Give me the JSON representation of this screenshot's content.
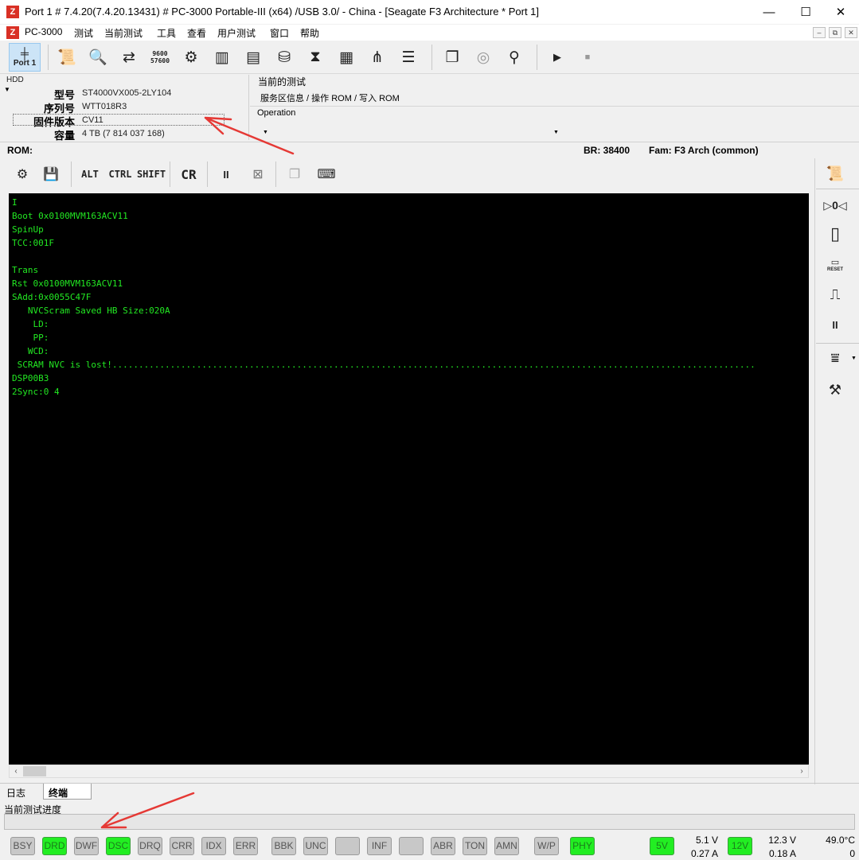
{
  "window": {
    "title": "Port 1 # 7.4.20(7.4.20.13431) # PC-3000 Portable-III (x64) /USB 3.0/ - China - [Seagate F3 Architecture * Port 1]",
    "min": "—",
    "max": "☐",
    "close": "✕",
    "icon_glyph": "Z"
  },
  "menu": {
    "items": [
      "PC-3000",
      "测试",
      "当前测试",
      "工具",
      "查看",
      "用户测试",
      "窗口",
      "帮助"
    ],
    "mdi": [
      "–",
      "⧉",
      "✕"
    ]
  },
  "toolbar": {
    "port_label": "Port 1",
    "baud_top": "9600",
    "baud_bottom": "57600",
    "play": "▶",
    "stop": "■"
  },
  "hdd": {
    "label": "HDD",
    "caret": "▼",
    "fields": [
      {
        "name": "型号",
        "value": "ST4000VX005-2LY104"
      },
      {
        "name": "序列号",
        "value": "WTT018R3"
      },
      {
        "name": "固件版本",
        "value": "CV11"
      },
      {
        "name": "容量",
        "value": "4 TB (7 814 037 168)"
      }
    ]
  },
  "current_test": {
    "title": "当前的测试",
    "value": "服务区信息 / 操作 ROM / 写入 ROM",
    "operation_label": "Operation",
    "caret": "▼"
  },
  "rom_bar": {
    "rom_label": "ROM:",
    "br": "BR: 38400",
    "fam": "Fam: F3 Arch (common)"
  },
  "term_toolbar": {
    "alt": "ALT",
    "ctrl": "CTRL",
    "shift": "SHIFT",
    "cr": "CR",
    "pause": "II"
  },
  "terminal": {
    "lines": [
      "I",
      "Boot 0x0100MVM163ACV11",
      "SpinUp",
      "TCC:001F",
      "",
      "Trans",
      "Rst 0x0100MVM163ACV11",
      "SAdd:0x0055C47F",
      "   NVCScram Saved HB Size:020A",
      "    LD:",
      "    PP:",
      "   WCD:",
      " SCRAM NVC is lost!..........................................................................................................................",
      "DSP00B3",
      "2Sync:0 4"
    ]
  },
  "right_panel": {
    "reset_label": "RESET",
    "pause": "II"
  },
  "tabs": [
    "日志",
    "终端"
  ],
  "progress": {
    "label": "当前测试进度",
    "fraction": 0
  },
  "leds": [
    {
      "label": "BSY",
      "on": false
    },
    {
      "label": "DRD",
      "on": true
    },
    {
      "label": "DWF",
      "on": false
    },
    {
      "label": "DSC",
      "on": true
    },
    {
      "label": "DRQ",
      "on": false
    },
    {
      "label": "CRR",
      "on": false
    },
    {
      "label": "IDX",
      "on": false
    },
    {
      "label": "ERR",
      "on": false
    },
    {
      "label": "BBK",
      "on": false
    },
    {
      "label": "UNC",
      "on": false
    },
    {
      "label": "",
      "on": false
    },
    {
      "label": "INF",
      "on": false
    },
    {
      "label": "",
      "on": false
    },
    {
      "label": "ABR",
      "on": false
    },
    {
      "label": "TON",
      "on": false
    },
    {
      "label": "AMN",
      "on": false
    },
    {
      "label": "W/P",
      "on": false
    },
    {
      "label": "PHY",
      "on": true
    }
  ],
  "power": {
    "v5_label": "5V",
    "v5_voltage": "5.1 V",
    "v5_current": "0.27 A",
    "v12_label": "12V",
    "v12_voltage": "12.3 V",
    "v12_current": "0.18 A",
    "temperature": "49.0°C",
    "counter": "0"
  },
  "colors": {
    "terminal_text": "#22e822",
    "led_on": "#22ee22",
    "annotation_arrow": "#e53935"
  },
  "icons": [
    "app-icon",
    "port-icon",
    "scroll-icon",
    "magnifier-icon",
    "swap-icon",
    "baud-icon",
    "gears-icon",
    "chip-icon",
    "board-icon",
    "disk-icon",
    "heads-icon",
    "grid-icon",
    "flow-icon",
    "list-icon",
    "copy-icon",
    "platter-icon",
    "user-icon"
  ]
}
